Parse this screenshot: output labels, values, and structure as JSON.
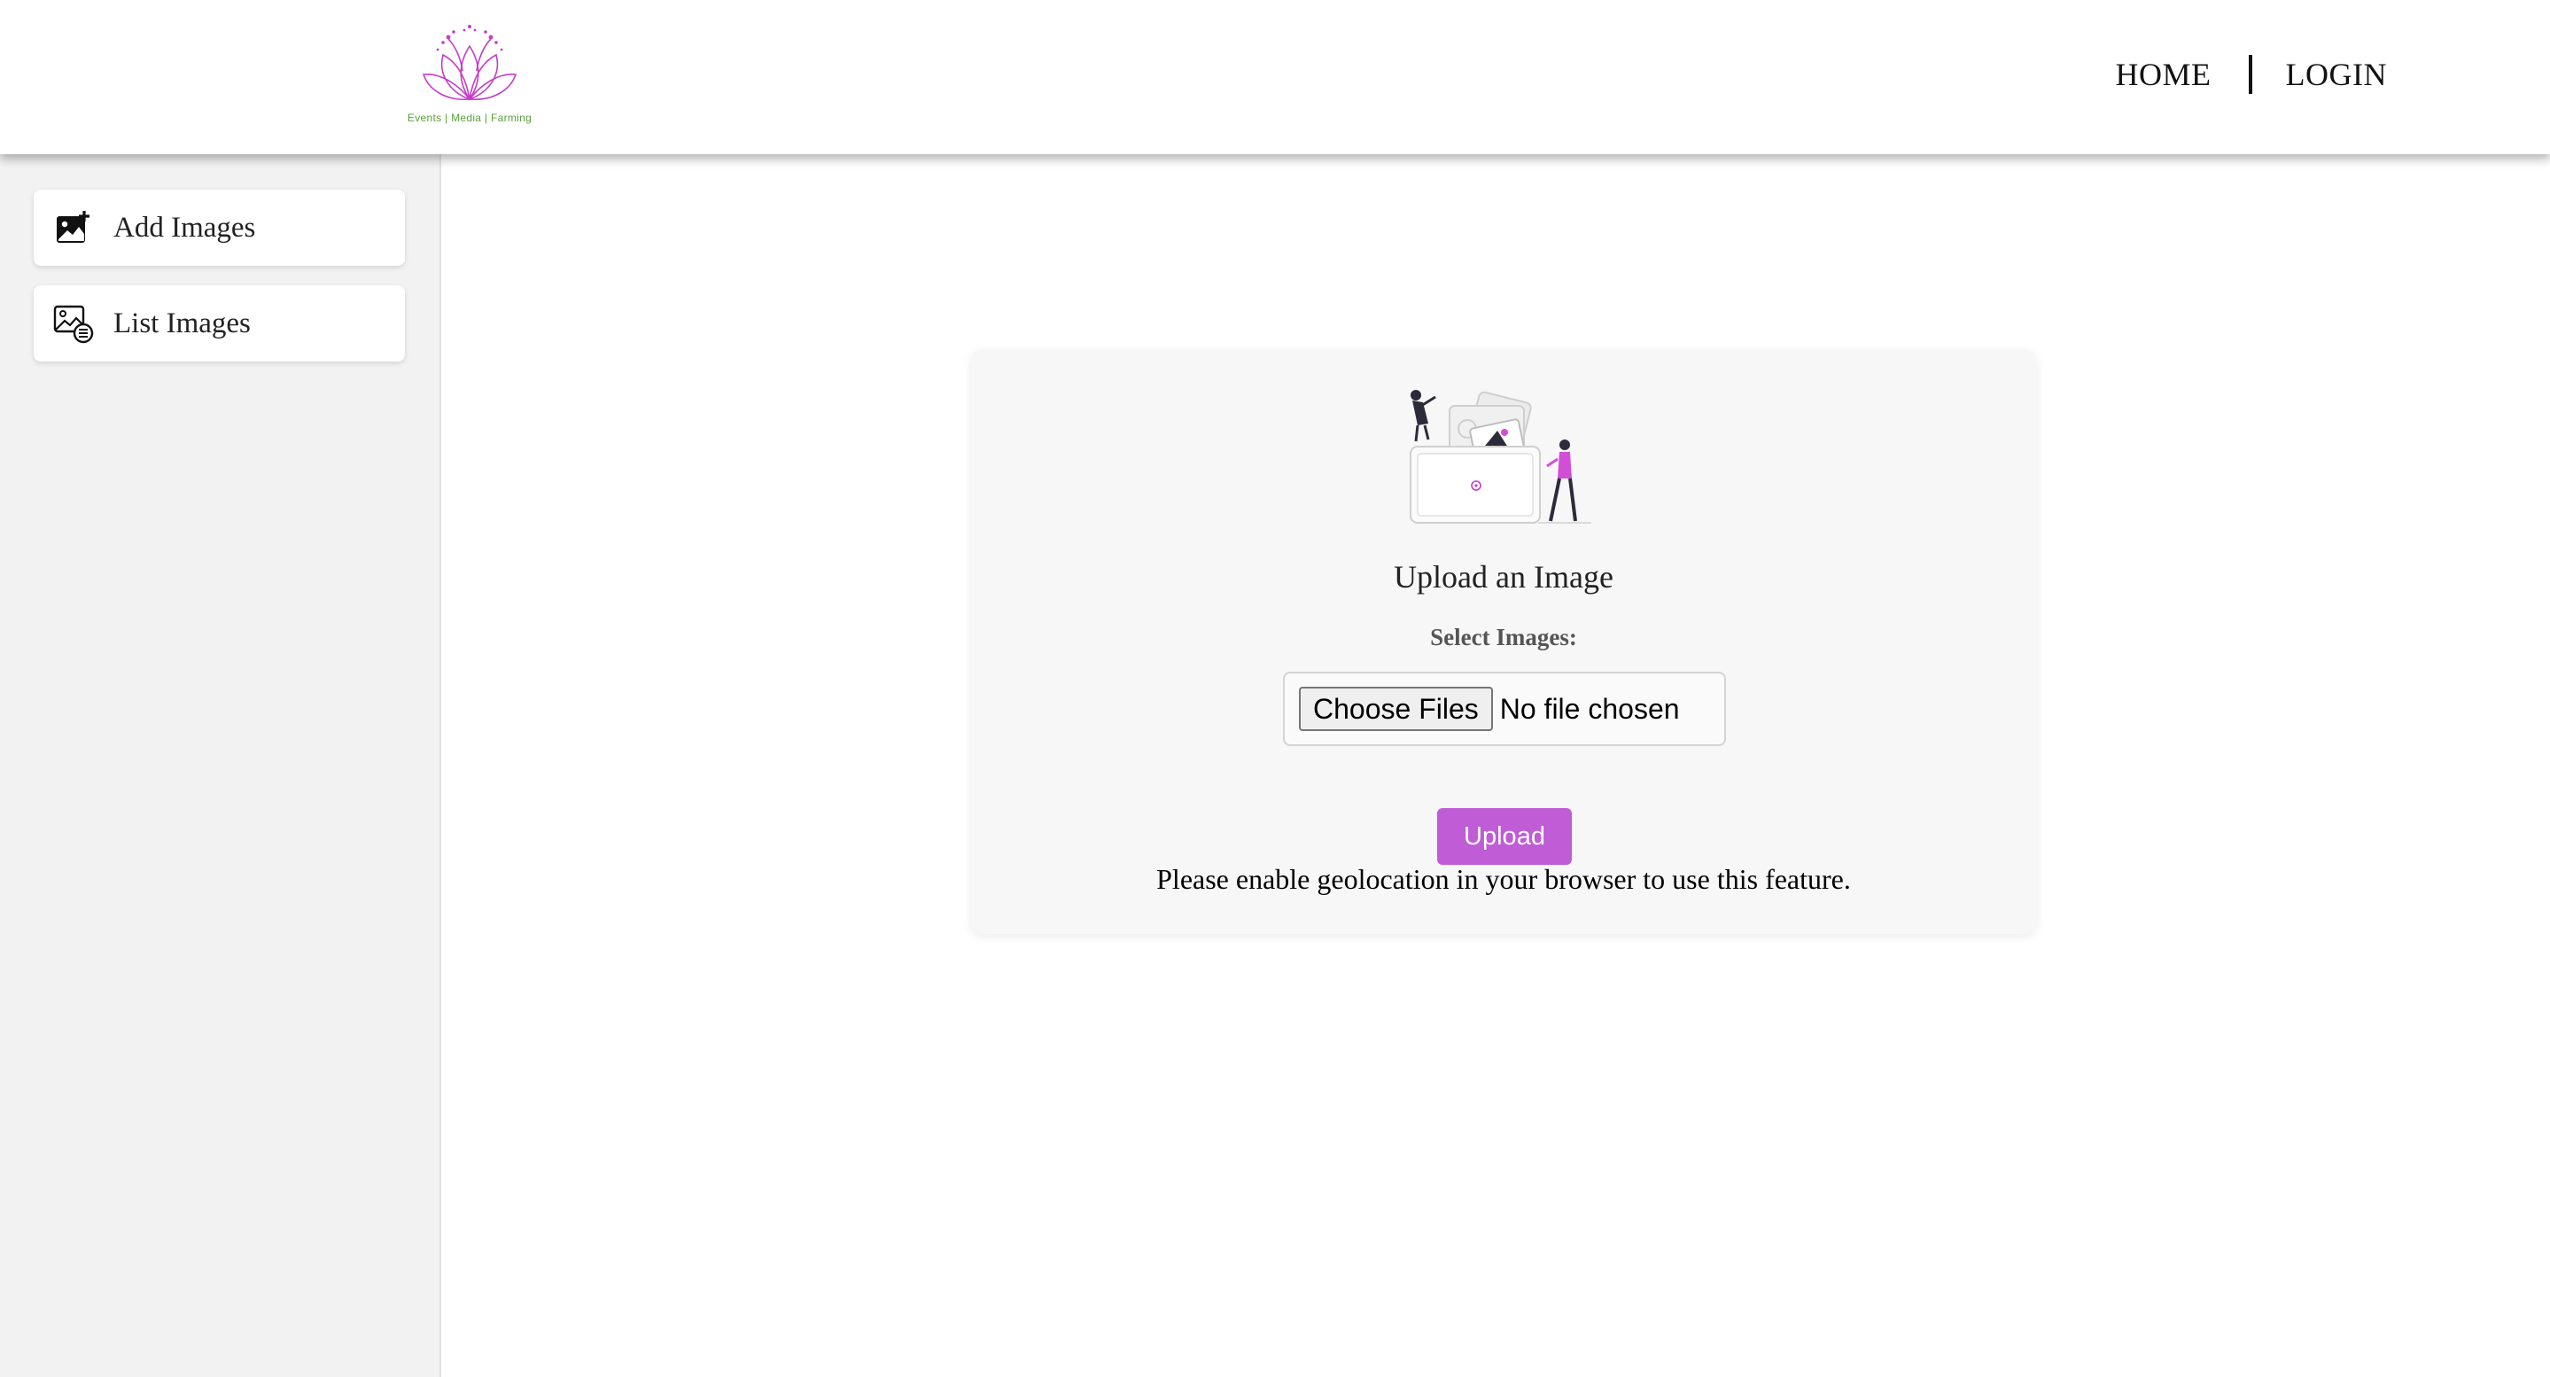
{
  "brand": {
    "tagline": "Events | Media | Farming",
    "logo_icon": "lotus-logo",
    "accent_color": "#bf5cd6",
    "tagline_color": "#5aa03c"
  },
  "nav": {
    "home_label": "HOME",
    "login_label": "LOGIN"
  },
  "sidebar": {
    "items": [
      {
        "label": "Add Images",
        "icon": "add-image-icon"
      },
      {
        "label": "List Images",
        "icon": "list-images-icon"
      }
    ]
  },
  "upload": {
    "title": "Upload an Image",
    "field_label": "Select Images:",
    "choose_button": "Choose Files",
    "file_status": "No file chosen",
    "submit_label": "Upload",
    "geolocation_message": "Please enable geolocation in your browser to use this feature."
  }
}
